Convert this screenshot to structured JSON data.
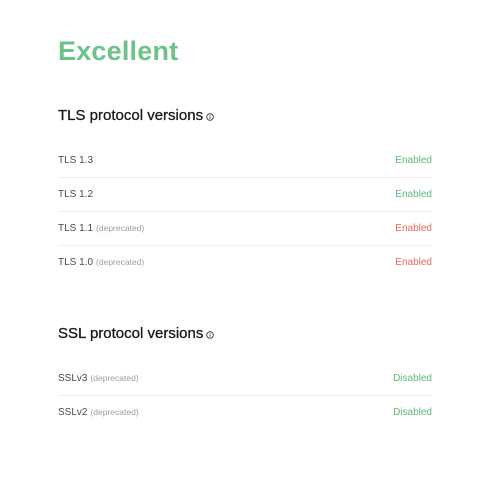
{
  "grade": "Excellent",
  "colors": {
    "good": "#5cb87a",
    "bad": "#ea6a58",
    "grade": "#6cc38a"
  },
  "tls": {
    "title": "TLS protocol versions",
    "icon": "info-icon",
    "rows": [
      {
        "name": "TLS 1.3",
        "note": "",
        "status": "Enabled",
        "tone": "good"
      },
      {
        "name": "TLS 1.2",
        "note": "",
        "status": "Enabled",
        "tone": "good"
      },
      {
        "name": "TLS 1.1",
        "note": "(deprecated)",
        "status": "Enabled",
        "tone": "bad"
      },
      {
        "name": "TLS 1.0",
        "note": "(deprecated)",
        "status": "Enabled",
        "tone": "bad"
      }
    ]
  },
  "ssl": {
    "title": "SSL protocol versions",
    "icon": "info-icon",
    "rows": [
      {
        "name": "SSLv3",
        "note": "(deprecated)",
        "status": "Disabled",
        "tone": "good"
      },
      {
        "name": "SSLv2",
        "note": "(deprecated)",
        "status": "Disabled",
        "tone": "good"
      }
    ]
  }
}
